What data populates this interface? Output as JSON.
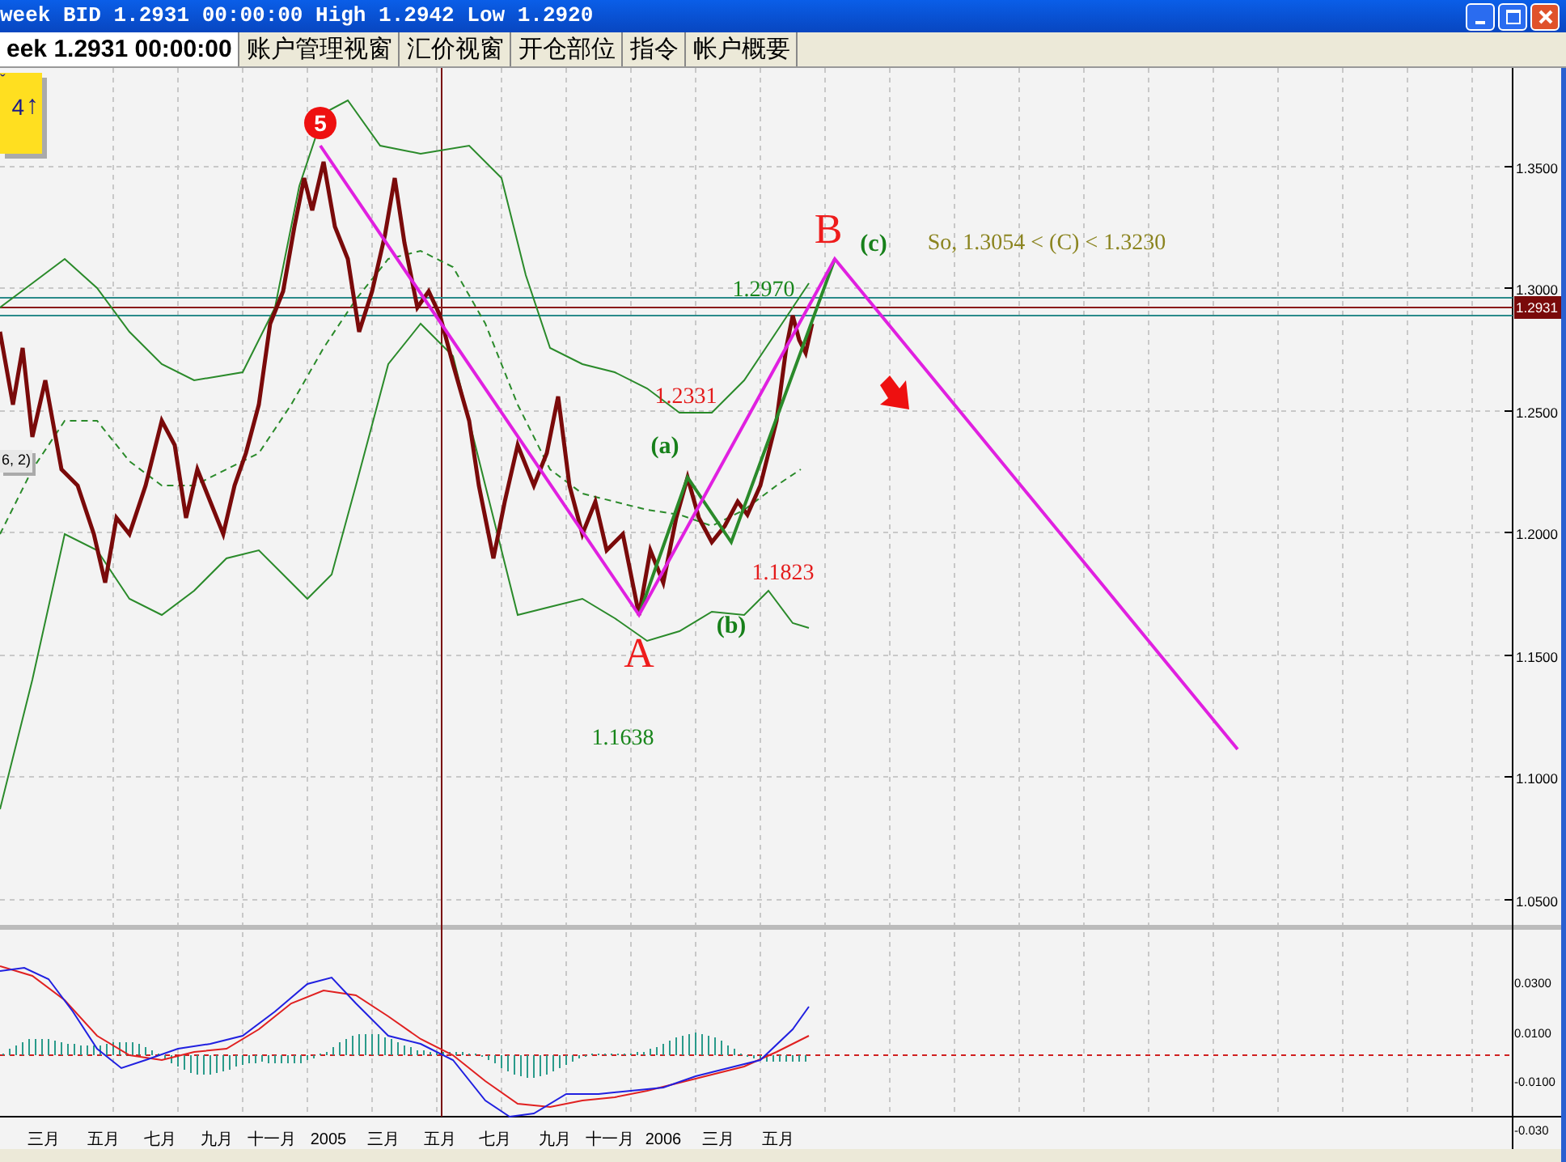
{
  "window": {
    "title": "week BID 1.2931 00:00:00 High 1.2942 Low 1.2920"
  },
  "tabs": [
    {
      "label": "eek 1.2931 00:00:00",
      "selected": true
    },
    {
      "label": "账户管理视窗",
      "selected": false
    },
    {
      "label": "汇价视窗",
      "selected": false
    },
    {
      "label": "开仓部位",
      "selected": false
    },
    {
      "label": "指令",
      "selected": false
    },
    {
      "label": "帐户概要",
      "selected": false
    }
  ],
  "quote_box": {
    "mark": "ˇ",
    "value": "4",
    "arrow": "↑"
  },
  "indicator_label": "6, 2)",
  "annotations": [
    {
      "text": "5",
      "kind": "wave_marker"
    },
    {
      "text": "1.2331",
      "kind": "price_red"
    },
    {
      "text": "(a)",
      "kind": "wave_green"
    },
    {
      "text": "1.1823",
      "kind": "price_red"
    },
    {
      "text": "(b)",
      "kind": "wave_green"
    },
    {
      "text": "A",
      "kind": "point"
    },
    {
      "text": "1.1638",
      "kind": "price_green"
    },
    {
      "text": "1.2970",
      "kind": "price_green"
    },
    {
      "text": "B",
      "kind": "point"
    },
    {
      "text": "(c)",
      "kind": "wave_green"
    },
    {
      "text": "So, 1.3054 < (C) < 1.3230",
      "kind": "note"
    }
  ],
  "price_axis": {
    "labels": [
      "1.3500",
      "1.3000",
      "1.2500",
      "1.2000",
      "1.1500",
      "1.1000",
      "1.0500"
    ],
    "current": "1.2931"
  },
  "oscillator_axis": {
    "labels": [
      "0.0300",
      "0.0100",
      "-0.0100",
      "-0.030"
    ]
  },
  "time_axis": {
    "labels": [
      "三月",
      "五月",
      "七月",
      "九月",
      "十一月",
      "2005",
      "三月",
      "五月",
      "七月",
      "九月",
      "十一月",
      "2006",
      "三月",
      "五月"
    ]
  }
}
